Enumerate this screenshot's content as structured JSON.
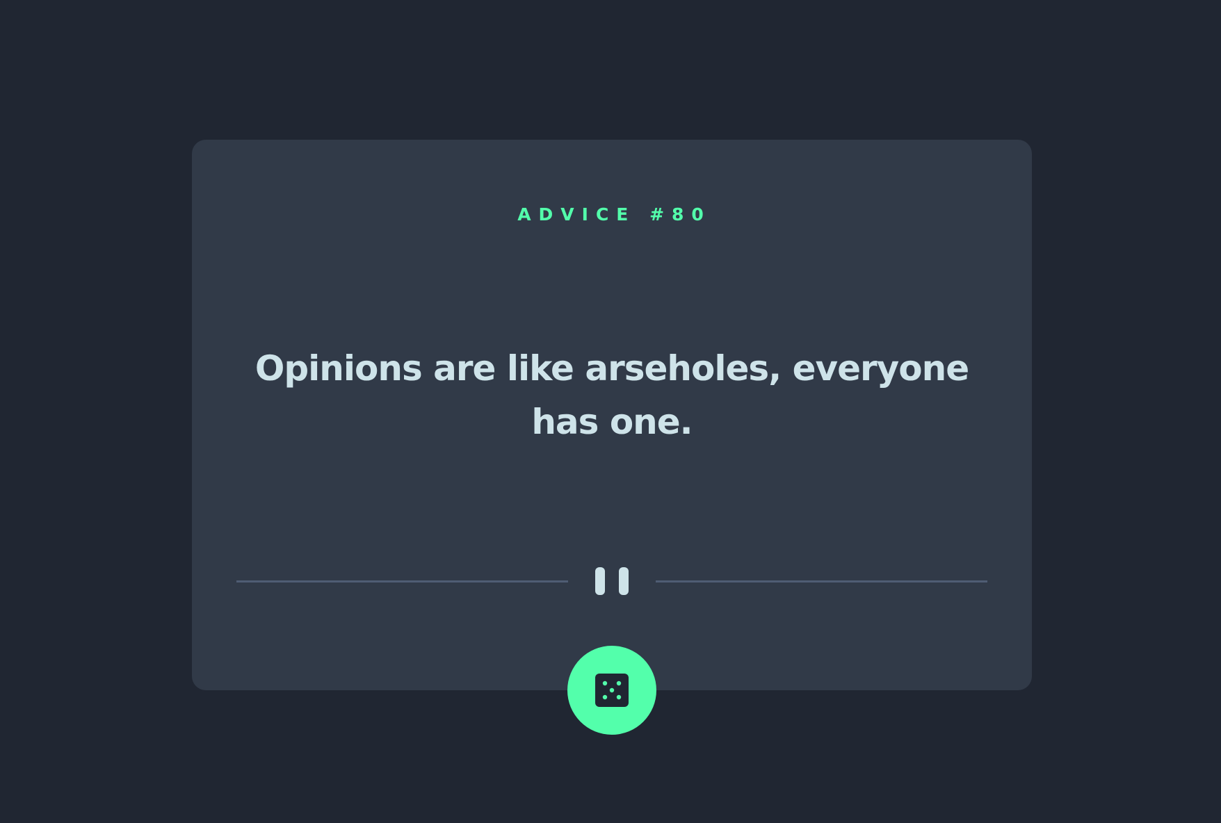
{
  "advice": {
    "label": "ADVICE #80",
    "quote": "Opinions are like arseholes, everyone has one."
  },
  "divider": {
    "icon": "pause-icon"
  },
  "dice_button": {
    "icon": "dice-icon"
  },
  "colors": {
    "background": "#202632",
    "card": "#313a48",
    "accent": "#53ffab",
    "text": "#cee3e9",
    "divider": "#4f5d74"
  }
}
